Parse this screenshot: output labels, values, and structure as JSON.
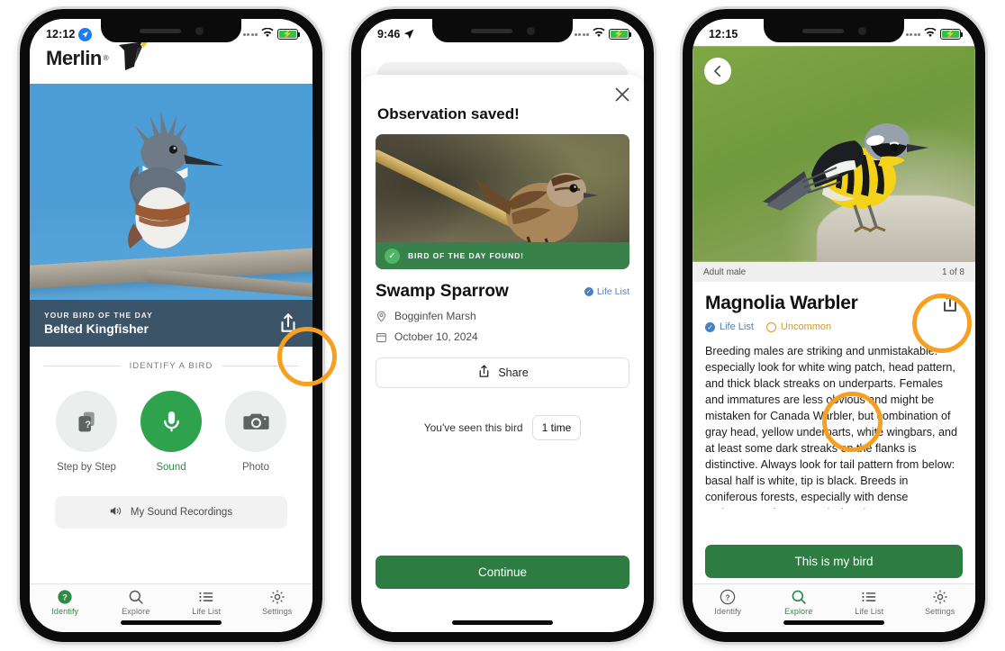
{
  "phone1": {
    "status": {
      "time": "12:12",
      "location_icon": "location-arrow-icon",
      "wifi": "wifi-icon",
      "battery": "battery-charging-icon"
    },
    "brand": {
      "name": "Merlin",
      "trademark": "®",
      "logo_icon": "merlin-bird-logo"
    },
    "hero": {
      "photo_alt": "belted-kingfisher-photo"
    },
    "bird_of_day": {
      "kicker": "YOUR BIRD OF THE DAY",
      "name": "Belted Kingfisher",
      "share_icon": "share-icon"
    },
    "identify": {
      "section_label": "IDENTIFY A BIRD",
      "methods": [
        {
          "label": "Step by Step",
          "icon": "question-cards-icon",
          "active": false
        },
        {
          "label": "Sound",
          "icon": "microphone-icon",
          "active": true
        },
        {
          "label": "Photo",
          "icon": "camera-icon",
          "active": false
        }
      ]
    },
    "recordings": {
      "label": "My Sound Recordings",
      "icon": "speaker-icon"
    },
    "tabs": [
      {
        "label": "Identify",
        "icon": "question-circle-icon",
        "active": true
      },
      {
        "label": "Explore",
        "icon": "search-icon",
        "active": false
      },
      {
        "label": "Life List",
        "icon": "list-icon",
        "active": false
      },
      {
        "label": "Settings",
        "icon": "gear-icon",
        "active": false
      }
    ]
  },
  "phone2": {
    "status": {
      "time": "9:46",
      "location_icon": "location-arrow-icon",
      "wifi": "wifi-icon",
      "battery": "battery-charging-icon"
    },
    "sheet": {
      "title": "Observation saved!",
      "close_icon": "close-icon",
      "photo_alt": "swamp-sparrow-photo",
      "found_banner": {
        "text": "BIRD OF THE DAY FOUND!",
        "icon": "check-circle-icon"
      },
      "bird_name": "Swamp Sparrow",
      "life_list_badge": "Life List",
      "location": "Bogginfen Marsh",
      "location_icon": "map-pin-icon",
      "date": "October 10, 2024",
      "date_icon": "calendar-icon",
      "share_label": "Share",
      "share_icon": "share-icon",
      "seen_label": "You've seen this bird",
      "seen_count": "1 time",
      "continue_label": "Continue"
    }
  },
  "phone3": {
    "status": {
      "time": "12:15",
      "wifi": "wifi-icon",
      "battery": "battery-charging-icon"
    },
    "photo": {
      "alt": "magnolia-warbler-photo",
      "back_icon": "chevron-left-icon"
    },
    "caption": {
      "left": "Adult male",
      "right": "1 of 8"
    },
    "title": "Magnolia Warbler",
    "share_icon": "share-icon",
    "badges": [
      {
        "label": "Life List",
        "type": "life",
        "icon": "check-circle-icon"
      },
      {
        "label": "Uncommon",
        "type": "uncommon",
        "icon": "frequency-icon"
      }
    ],
    "description": "Breeding males are striking and unmistakable: especially look for white wing patch, head pattern, and thick black streaks on underparts. Females and immatures are less obvious and might be mistaken for Canada Warbler, but combination of gray head, yellow underparts, white wingbars, and at least some dark streaks on the flanks is distinctive. Always look for tail pattern from below: basal half is white, tip is black. Breeds in coniferous forests, especially with dense understory. Migrants and wintering",
    "cta_label": "This is my bird",
    "tabs": [
      {
        "label": "Identify",
        "icon": "question-circle-icon",
        "active": false
      },
      {
        "label": "Explore",
        "icon": "search-icon",
        "active": true
      },
      {
        "label": "Life List",
        "icon": "list-icon",
        "active": false
      },
      {
        "label": "Settings",
        "icon": "gear-icon",
        "active": false
      }
    ]
  },
  "colors": {
    "brand_green": "#2e8b45",
    "button_green": "#2d7d43",
    "highlight_orange": "#f5a020",
    "banner_slate": "#3c5468",
    "life_list_blue": "#4a7fc1",
    "uncommon_amber": "#d99a1d"
  }
}
